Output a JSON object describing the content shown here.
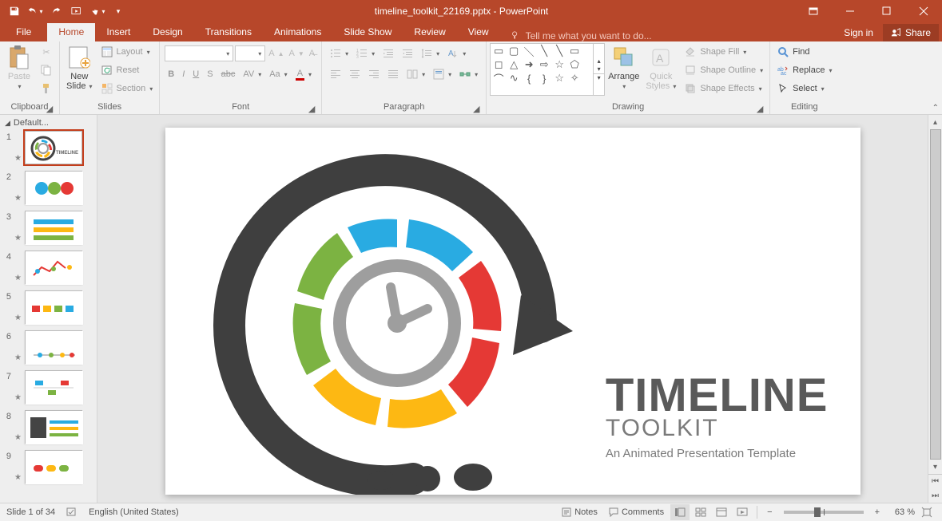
{
  "app": {
    "title": "timeline_toolkit_22169.pptx - PowerPoint"
  },
  "tabs": {
    "file": "File",
    "home": "Home",
    "insert": "Insert",
    "design": "Design",
    "transitions": "Transitions",
    "animations": "Animations",
    "slideshow": "Slide Show",
    "review": "Review",
    "view": "View",
    "tellme": "Tell me what you want to do..."
  },
  "account": {
    "signin": "Sign in",
    "share": "Share"
  },
  "ribbon": {
    "clipboard": {
      "label": "Clipboard",
      "paste": "Paste",
      "cut": "Cut",
      "copy": "Copy",
      "formatpainter": "Format Painter"
    },
    "slides": {
      "label": "Slides",
      "new": "New\nSlide",
      "layout": "Layout",
      "reset": "Reset",
      "section": "Section"
    },
    "font": {
      "label": "Font",
      "bold": "B",
      "italic": "I",
      "underline": "U",
      "shadow": "S",
      "strike": "abc",
      "spacing": "AV",
      "case": "Aa",
      "color": "A"
    },
    "paragraph": {
      "label": "Paragraph"
    },
    "drawing": {
      "label": "Drawing",
      "arrange": "Arrange",
      "quick": "Quick\nStyles",
      "fill": "Shape Fill",
      "outline": "Shape Outline",
      "effects": "Shape Effects"
    },
    "editing": {
      "label": "Editing",
      "find": "Find",
      "replace": "Replace",
      "select": "Select"
    }
  },
  "thumbs": {
    "section": "Default...",
    "count": 9,
    "selected": 1
  },
  "slide": {
    "title": "TIMELINE",
    "subtitle": "TOOLKIT",
    "tagline": "An Animated Presentation Template"
  },
  "status": {
    "slide": "Slide 1 of 34",
    "lang": "English (United States)",
    "notes": "Notes",
    "comments": "Comments",
    "zoom": "63 %"
  }
}
